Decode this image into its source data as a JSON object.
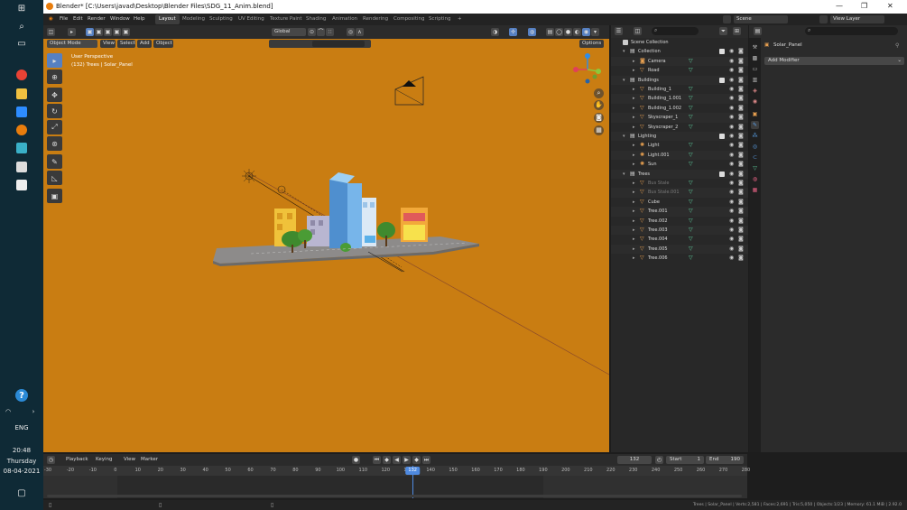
{
  "window": {
    "title": "Blender* [C:\\Users\\javad\\Desktop\\Blender Files\\SDG_11_Anim.blend]"
  },
  "menu": [
    "File",
    "Edit",
    "Render",
    "Window",
    "Help"
  ],
  "workspaces": [
    "Layout",
    "Modeling",
    "Sculpting",
    "UV Editing",
    "Texture Paint",
    "Shading",
    "Animation",
    "Rendering",
    "Compositing",
    "Scripting"
  ],
  "scene": {
    "name": "Scene",
    "view_layer": "View Layer"
  },
  "viewport": {
    "mode": "Object Mode",
    "menus": [
      "View",
      "Select",
      "Add",
      "Object"
    ],
    "transform": "Global",
    "options": "Options",
    "overlay_title": "User Perspective",
    "overlay_sub": "(132) Trees | Solar_Panel"
  },
  "outliner": {
    "root": "Scene Collection",
    "rows": [
      {
        "level": 1,
        "label": "Collection",
        "kind": "collection",
        "expanded": true
      },
      {
        "level": 2,
        "label": "Camera",
        "kind": "camera"
      },
      {
        "level": 2,
        "label": "Road",
        "kind": "mesh"
      },
      {
        "level": 1,
        "label": "Buildings",
        "kind": "collection",
        "expanded": true
      },
      {
        "level": 2,
        "label": "Building_1",
        "kind": "mesh"
      },
      {
        "level": 2,
        "label": "Building_1.001",
        "kind": "mesh"
      },
      {
        "level": 2,
        "label": "Building_1.002",
        "kind": "mesh"
      },
      {
        "level": 2,
        "label": "Skyscraper_1",
        "kind": "mesh"
      },
      {
        "level": 2,
        "label": "Skyscraper_2",
        "kind": "mesh"
      },
      {
        "level": 1,
        "label": "Lighting",
        "kind": "collection",
        "expanded": true
      },
      {
        "level": 2,
        "label": "Light",
        "kind": "light"
      },
      {
        "level": 2,
        "label": "Light.001",
        "kind": "light"
      },
      {
        "level": 2,
        "label": "Sun",
        "kind": "light"
      },
      {
        "level": 1,
        "label": "Trees",
        "kind": "collection",
        "expanded": true
      },
      {
        "level": 2,
        "label": "Bus Stale",
        "kind": "mesh",
        "dim": true
      },
      {
        "level": 2,
        "label": "Bus Stale.001",
        "kind": "mesh",
        "dim": true
      },
      {
        "level": 2,
        "label": "Cube",
        "kind": "mesh"
      },
      {
        "level": 2,
        "label": "Tree.001",
        "kind": "mesh"
      },
      {
        "level": 2,
        "label": "Tree.002",
        "kind": "mesh"
      },
      {
        "level": 2,
        "label": "Tree.003",
        "kind": "mesh"
      },
      {
        "level": 2,
        "label": "Tree.004",
        "kind": "mesh"
      },
      {
        "level": 2,
        "label": "Tree.005",
        "kind": "mesh"
      },
      {
        "level": 2,
        "label": "Tree.006",
        "kind": "mesh"
      }
    ]
  },
  "properties": {
    "object": "Solar_Panel",
    "add_modifier": "Add Modifier"
  },
  "timeline": {
    "menus": [
      "Playback",
      "Keying",
      "View",
      "Marker"
    ],
    "current_frame": "132",
    "start_label": "Start",
    "start": "1",
    "end_label": "End",
    "end": "190",
    "ticks": [
      "-30",
      "-20",
      "-10",
      "0",
      "10",
      "20",
      "30",
      "40",
      "50",
      "60",
      "70",
      "80",
      "90",
      "100",
      "110",
      "120",
      "130",
      "140",
      "150",
      "160",
      "170",
      "180",
      "190",
      "200",
      "210",
      "220",
      "230",
      "240",
      "250",
      "260",
      "270",
      "280"
    ]
  },
  "status": {
    "text": "Trees | Solar_Panel | Verts:2,581 | Faces:2,691 | Tris:5,050 | Objects:1/23 | Memory: 61.1 MiB | 2.92.0"
  },
  "taskbar": {
    "lang": "ENG",
    "time": "20:48",
    "day": "Thursday",
    "date": "08-04-2021"
  },
  "colors": {
    "viewport_bg": "#c97d12",
    "accent": "#4f8ae0",
    "blender_orange": "#e87d0d"
  }
}
